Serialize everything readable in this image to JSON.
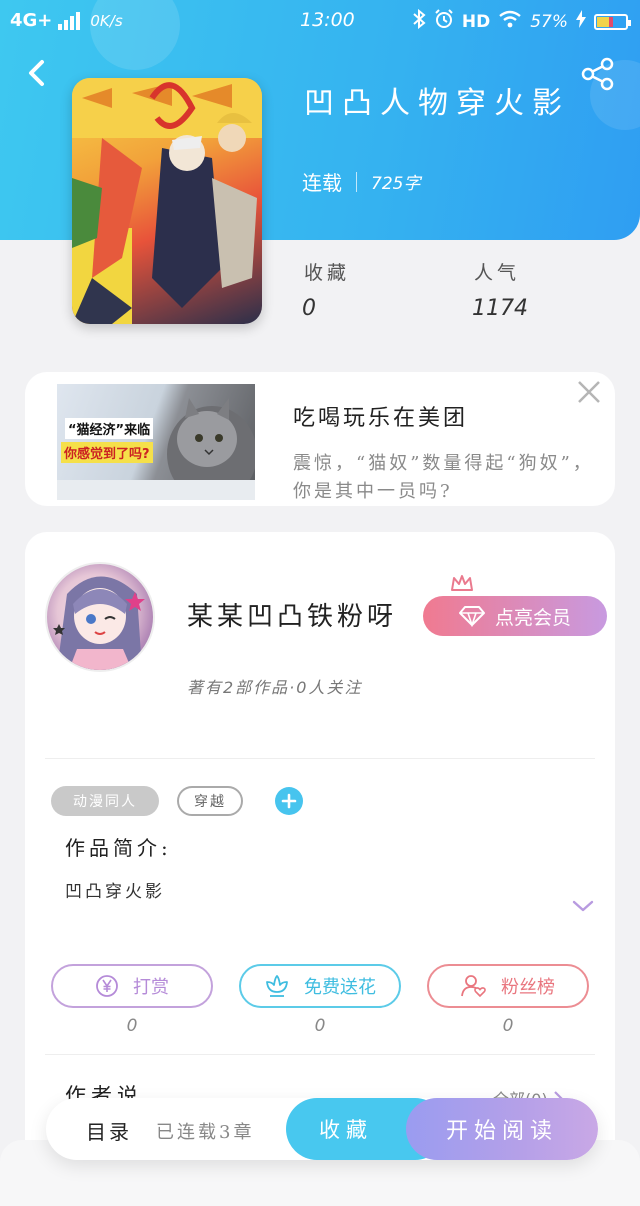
{
  "status_bar": {
    "network": "4G+",
    "speed": "0K/s",
    "time": "13:00",
    "hd": "HD",
    "battery": "57%"
  },
  "book": {
    "title": "凹凸人物穿火影",
    "status": "连载",
    "word_count": "725字",
    "favorites_label": "收藏",
    "favorites_value": "0",
    "popularity_label": "人气",
    "popularity_value": "1174"
  },
  "ad": {
    "image_caption_1": "“猫经济”来临",
    "image_caption_2": "你感觉到了吗?",
    "title": "吃喝玩乐在美团",
    "description": "震惊，“猫奴”数量得起“狗奴”，你是其中一员吗?"
  },
  "author": {
    "name": "某某凹凸铁粉呀",
    "vip_button": "点亮会员",
    "subtitle": "著有2部作品·0人关注"
  },
  "tags": [
    "动漫同人",
    "穿越"
  ],
  "intro": {
    "label": "作品简介:",
    "text": "凹凸穿火影"
  },
  "actions": {
    "reward_label": "打赏",
    "reward_count": "0",
    "flower_label": "免费送花",
    "flower_count": "0",
    "fans_label": "粉丝榜",
    "fans_count": "0"
  },
  "author_says": {
    "label": "作者说",
    "all_link": "全部(0)"
  },
  "bottom_bar": {
    "catalog": "目录",
    "chapters": "已连载3章",
    "collect": "收藏",
    "read": "开始阅读"
  },
  "colors": {
    "header_blue": "#3ec8f0",
    "accent_cyan": "#48c8ef",
    "vip_pink": "#f07a90",
    "read_purple": "#9a9cf0"
  }
}
